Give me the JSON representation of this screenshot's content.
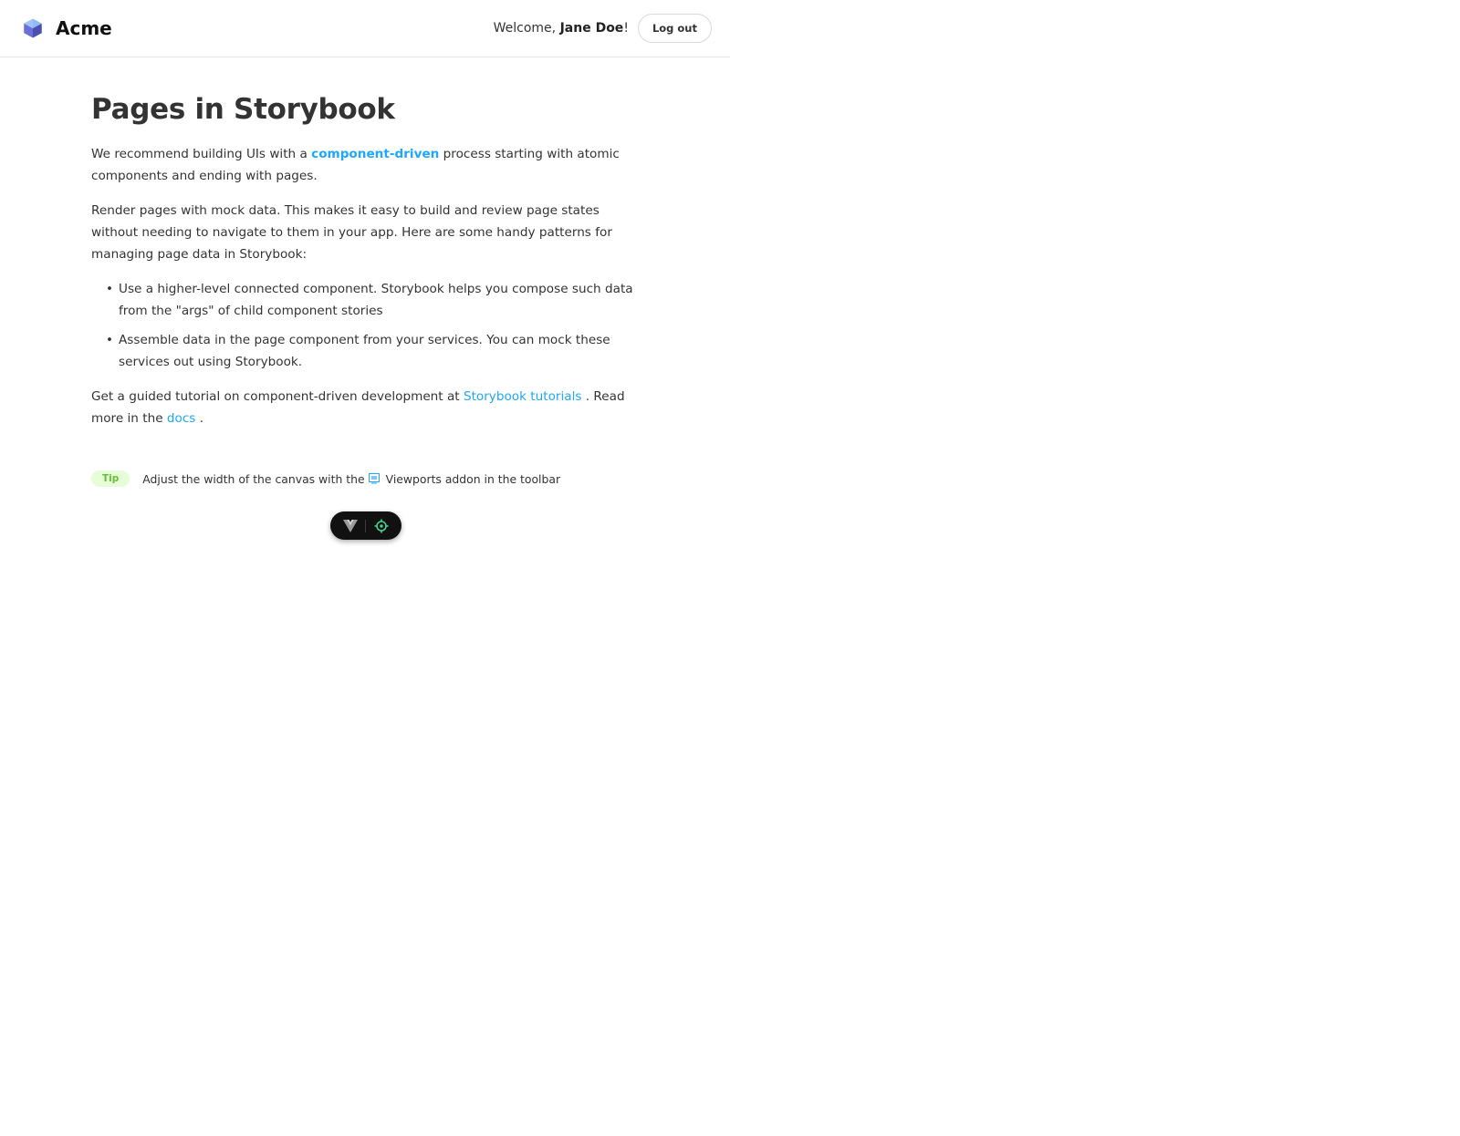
{
  "header": {
    "brand_name": "Acme",
    "welcome_prefix": "Welcome, ",
    "user_name": "Jane Doe",
    "welcome_suffix": "!",
    "logout_label": "Log out"
  },
  "page": {
    "title": "Pages in Storybook",
    "intro": {
      "before": "We recommend building UIs with a ",
      "link": "component-driven",
      "after": " process starting with atomic components and ending with pages."
    },
    "mock_paragraph": "Render pages with mock data. This makes it easy to build and review page states without needing to navigate to them in your app. Here are some handy patterns for managing page data in Storybook:",
    "bullets": [
      "Use a higher-level connected component. Storybook helps you compose such data from the \"args\" of child component stories",
      "Assemble data in the page component from your services. You can mock these services out using Storybook."
    ],
    "tutorial": {
      "before": "Get a guided tutorial on component-driven development at ",
      "tutorials_link": "Storybook tutorials",
      "middle": " . Read more in the ",
      "docs_link": "docs",
      "after": " ."
    },
    "tip": {
      "badge": "Tip",
      "before": "Adjust the width of the canvas with the ",
      "after": "Viewports addon in the toolbar",
      "icon": "viewport-icon"
    }
  },
  "devtools": {
    "icons": [
      "vue-logo-icon",
      "target-icon"
    ]
  },
  "colors": {
    "link": "#1ea7fd",
    "tip_bg": "#e7fdd8",
    "tip_text": "#66bf3c",
    "pill_bg": "#111111",
    "target_green": "#42d392"
  }
}
